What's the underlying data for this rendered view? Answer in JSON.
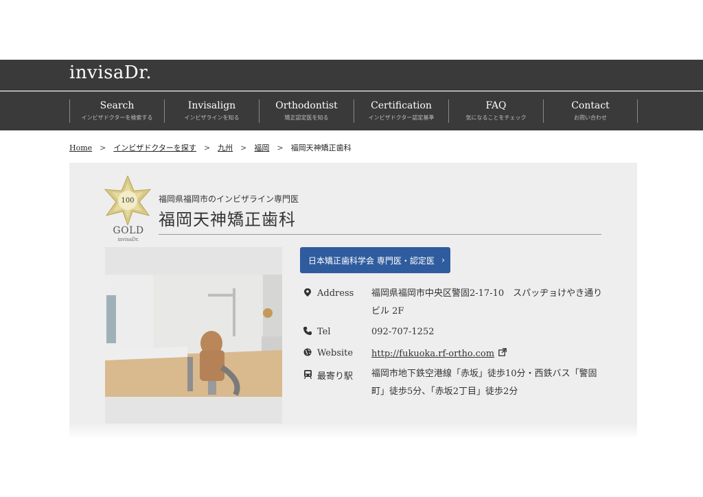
{
  "header": {
    "logo": "invisaDr.",
    "nav": [
      {
        "title": "Search",
        "sub": "インビザドクターを検索する"
      },
      {
        "title": "Invisalign",
        "sub": "インビザラインを知る"
      },
      {
        "title": "Orthodontist",
        "sub": "矯正認定医を知る"
      },
      {
        "title": "Certification",
        "sub": "インビザドクター認定基準"
      },
      {
        "title": "FAQ",
        "sub": "気になることをチェック"
      },
      {
        "title": "Contact",
        "sub": "お問い合わせ"
      }
    ]
  },
  "breadcrumb": {
    "items": [
      "Home",
      "インビザドクターを探す",
      "九州",
      "福岡"
    ],
    "current": "福岡天神矯正歯科",
    "separator": ">"
  },
  "badge": {
    "number": "100",
    "label": "GOLD",
    "brand": "invisaDr.",
    "color": "#c9b86a"
  },
  "clinic": {
    "subtitle": "福岡県福岡市のインビザライン専門医",
    "name": "福岡天神矯正歯科",
    "cert_button": "日本矯正歯科学会 専門医・認定医",
    "cert_button_color": "#2f5c9e",
    "info": {
      "address_label": "Address",
      "address_line1": "福岡県福岡市中央区警固2-17-10　スパッヂョけやき通り",
      "address_line2": "ビル 2F",
      "tel_label": "Tel",
      "tel": "092-707-1252",
      "website_label": "Website",
      "website": "http://fukuoka.rf-ortho.com",
      "station_label": "最寄り駅",
      "station_line1": "福岡市地下鉄空港線「赤坂」徒歩10分・西鉄バス「警固",
      "station_line2": "町」徒歩5分、「赤坂2丁目」徒歩2分"
    },
    "icons": {
      "address": "map-pin-icon",
      "tel": "phone-icon",
      "website": "globe-icon",
      "station": "train-icon",
      "external": "external-link-icon"
    }
  }
}
